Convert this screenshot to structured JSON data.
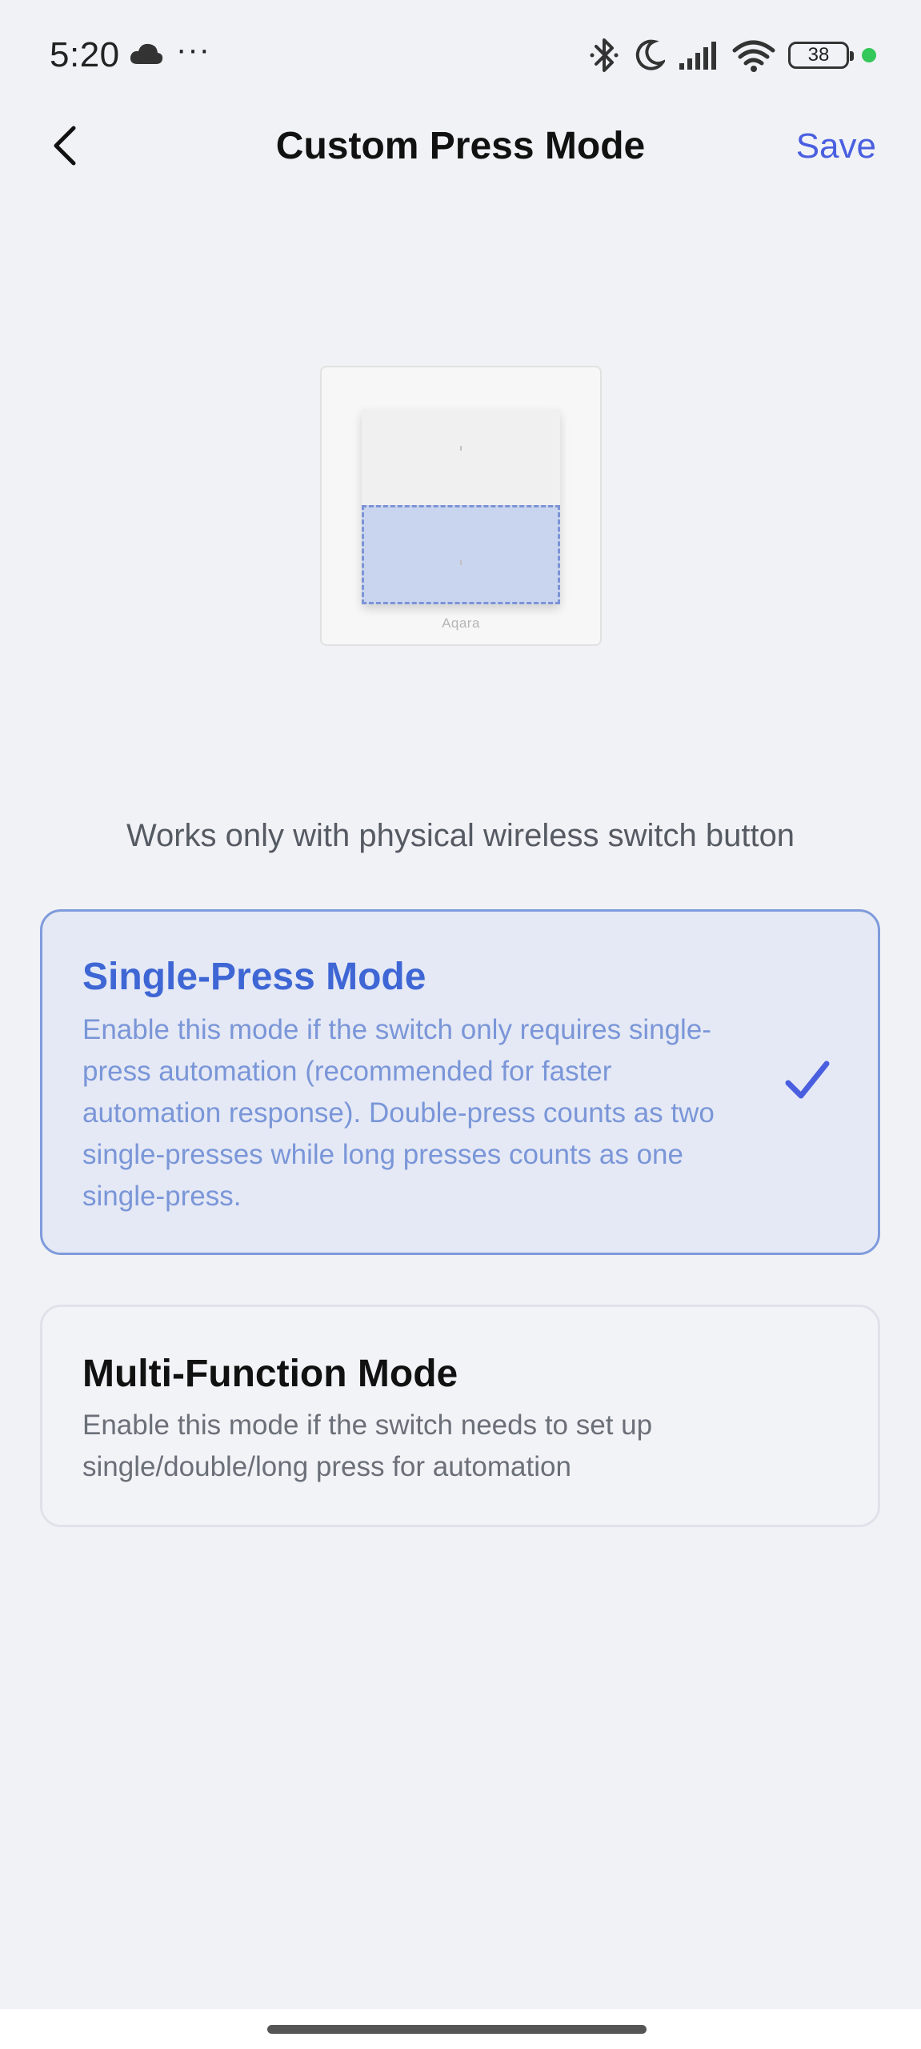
{
  "status_bar": {
    "time": "5:20",
    "more_dots": "···",
    "battery_level": "38",
    "icons": [
      "cloud-icon",
      "bluetooth-icon",
      "moon-icon",
      "signal-icon",
      "wifi-icon",
      "battery-icon",
      "green-status-dot"
    ]
  },
  "nav": {
    "back_icon": "chevron-left-icon",
    "title": "Custom Press Mode",
    "save_label": "Save"
  },
  "illustration": {
    "brand": "Aqara",
    "highlight_color": "#c9d4ee",
    "dash_color": "#7c93d6"
  },
  "note": "Works only with physical wireless switch button",
  "modes": [
    {
      "title": "Single-Press Mode",
      "description": "Enable this mode if the switch only requires single-press automation (recommended for faster automation response). Double-press counts as two single-presses while long presses counts as one single-press.",
      "selected": true
    },
    {
      "title": "Multi-Function Mode",
      "description": "Enable this mode if the switch needs to set up single/double/long press for automation",
      "selected": false
    }
  ],
  "colors": {
    "accent": "#4a5fe0",
    "selected_title": "#3e66d4",
    "selected_border": "#7f9bdc",
    "selected_bg": "#e5e9f5",
    "background": "#f1f2f6"
  }
}
